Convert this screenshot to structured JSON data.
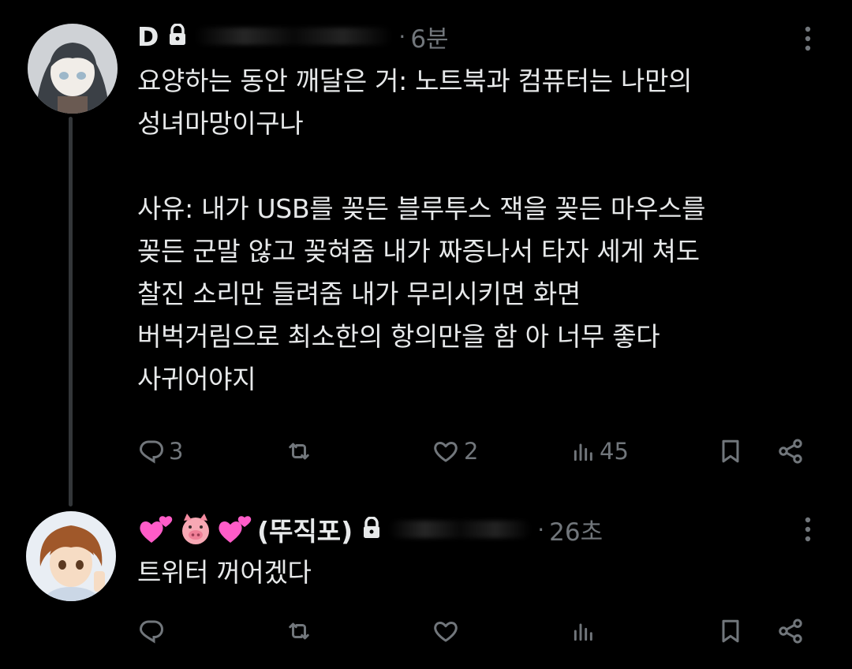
{
  "tweets": [
    {
      "name": "D",
      "time": "6분",
      "text": "요양하는 동안 깨달은 거: 노트북과 컴퓨터는 나만의\n성녀마망이구나\n\n사유: 내가 USB를 꽂든 블루투스 잭을 꽂든 마우스를\n꽂든 군말 않고 꽂혀줌 내가 짜증나서 타자 세게 쳐도\n찰진 소리만 들려줌 내가 무리시키면 화면\n버벅거림으로 최소한의 항의만을 함 아 너무 좋다\n사귀어야지",
      "reply_count": "3",
      "retweet_count": "",
      "like_count": "2",
      "view_count": "45"
    },
    {
      "name_emoji": [
        "💕",
        "🐷",
        "💕"
      ],
      "name": "(뚜직포)",
      "time": "26초",
      "text": "트위터 꺼어겠다",
      "reply_count": "",
      "retweet_count": "",
      "like_count": "",
      "view_count": ""
    }
  ],
  "separator": "·",
  "icons": [
    "lock-icon",
    "more-icon",
    "reply-icon",
    "retweet-icon",
    "like-icon",
    "views-icon",
    "bookmark-icon",
    "share-icon"
  ],
  "colors": {
    "background": "#000000",
    "text": "#e7e9ea",
    "secondary": "#71767b",
    "thread_line": "#333639",
    "emoji_pink": "#ff5cc8",
    "emoji_pig": "#f7a8b4"
  }
}
